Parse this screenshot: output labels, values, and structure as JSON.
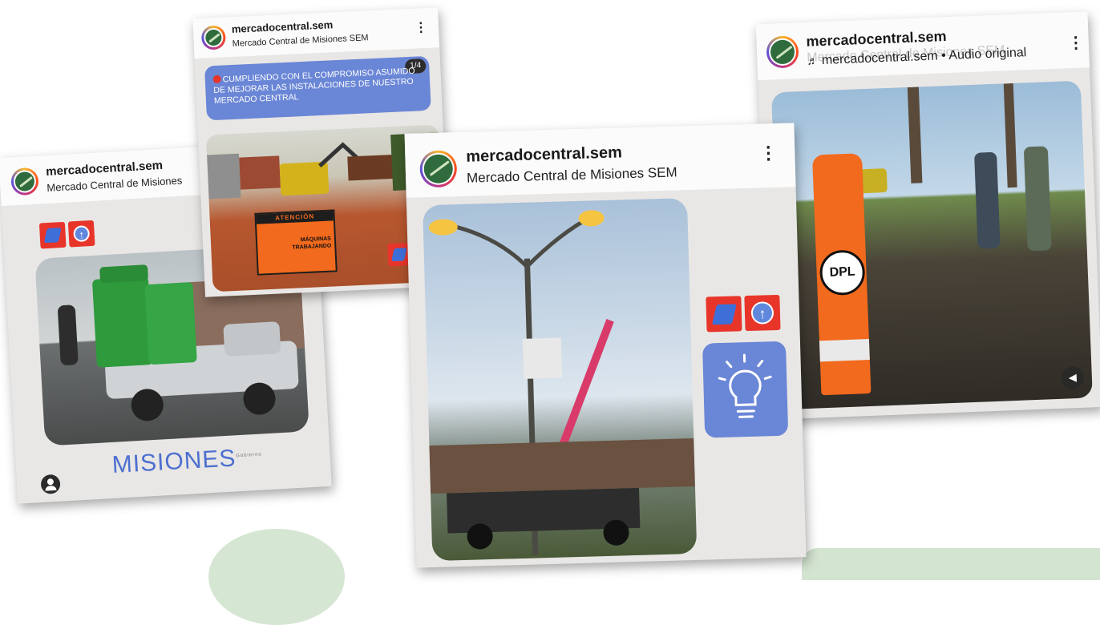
{
  "colors": {
    "accent_blue": "#6a86d6",
    "badge_red": "#e8352a",
    "cone_orange": "#f26a1d",
    "soft_green": "#d9ead9"
  },
  "card_left": {
    "username": "mercadocentral.sem",
    "subtitle": "Mercado Central de Misiones",
    "brand": "MISIONES",
    "brand_tm": "Gobierno",
    "icons": [
      "misiones-logo-icon",
      "upload-arrow-icon",
      "account-icon"
    ]
  },
  "card_top": {
    "username": "mercadocentral.sem",
    "subtitle": "Mercado Central de Misiones SEM",
    "slide_counter": "1/4",
    "caption": "CUMPLIENDO CON EL COMPROMISO ASUMIDO DE MEJORAR LAS INSTALACIONES DE NUESTRO MERCADO CENTRAL",
    "sign_title": "ATENCIÓN",
    "sign_body": "MÁQUINAS TRABAJANDO"
  },
  "card_center": {
    "username": "mercadocentral.sem",
    "subtitle": "Mercado Central de Misiones SEM",
    "icons": [
      "lightbulb-icon",
      "misiones-logo-icon",
      "upload-arrow-icon"
    ]
  },
  "card_right": {
    "username": "mercadocentral.sem",
    "ghost_text": "Mercado Central de Misiones SEM",
    "audio": "mercadocentral.sem • Audio original",
    "cone_label": "DPL",
    "icons": [
      "music-note-icon",
      "speaker-icon"
    ]
  }
}
